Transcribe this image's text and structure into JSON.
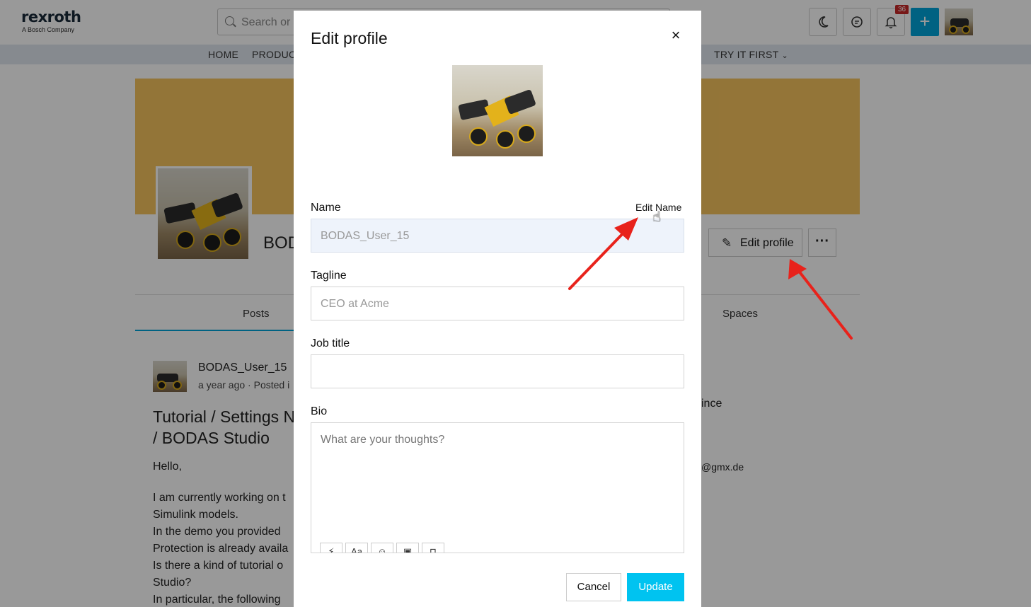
{
  "header": {
    "logo": "rexroth",
    "logo_sub": "A Bosch Company",
    "search_placeholder": "Search or",
    "notification_count": "36"
  },
  "nav": {
    "items": [
      "HOME",
      "PRODUC",
      "TRY IT FIRST"
    ]
  },
  "profile": {
    "name_partial": "BOD",
    "edit_profile_label": "Edit profile",
    "more_label": "···"
  },
  "tabs": {
    "posts": "Posts",
    "spaces": "Spaces"
  },
  "post": {
    "user": "BODAS_User_15",
    "meta": "a year ago · Posted i",
    "title_line1": "Tutorial / Settings N",
    "title_line2": "/ BODAS Studio",
    "lines": [
      "Hello,",
      "I am currently working on t",
      "Simulink models.",
      "In the demo you provided",
      "Protection is already availa",
      "Is there a kind of tutorial o",
      "Studio?",
      "In particular, the following"
    ]
  },
  "sidebar": {
    "since_partial": "ince",
    "email_partial": "@gmx.de"
  },
  "modal": {
    "title": "Edit profile",
    "close": "×",
    "name_label": "Name",
    "edit_name_link": "Edit Name",
    "name_value": "BODAS_User_15",
    "tagline_label": "Tagline",
    "tagline_placeholder": "CEO at Acme",
    "job_title_label": "Job title",
    "job_title_value": "",
    "bio_label": "Bio",
    "bio_placeholder": "What are your thoughts?",
    "toolbar": [
      "⚡",
      "Aa",
      "☺",
      "▣",
      "⊓"
    ],
    "cancel_label": "Cancel",
    "update_label": "Update"
  },
  "colors": {
    "accent": "#00a3d9",
    "update_button": "#00c3f0",
    "banner": "#f6c35e",
    "badge": "#c62828",
    "arrow": "#e8221b"
  }
}
